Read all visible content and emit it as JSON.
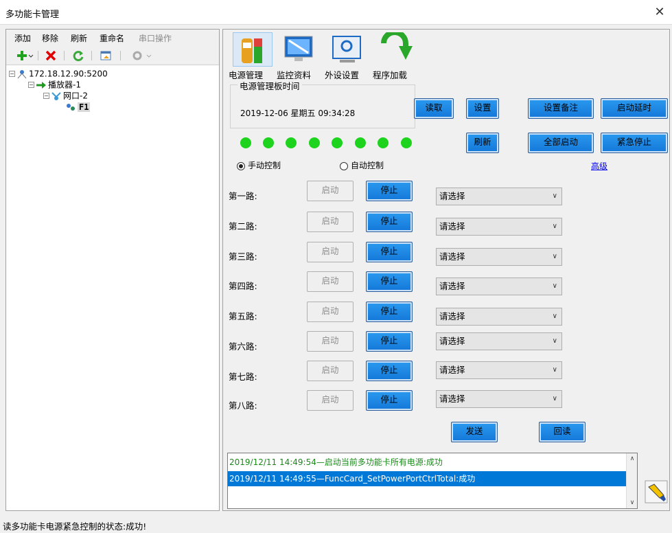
{
  "window": {
    "title": "多功能卡管理",
    "close_glyph": "✕"
  },
  "menu": {
    "items": [
      "添加",
      "移除",
      "刷新",
      "重命名",
      "串口操作"
    ]
  },
  "toolbar": {
    "icons": [
      "add-icon",
      "delete-icon",
      "refresh-icon",
      "window-icon",
      "settings-icon"
    ],
    "colors": {
      "add": "#1fa31f",
      "delete": "#e00000",
      "refresh": "#3aa83a"
    }
  },
  "tree": {
    "root": "172.18.12.90:5200",
    "player": "播放器-1",
    "port": "网口-2",
    "card": "F1"
  },
  "tabs": [
    {
      "label": "电源管理",
      "icon": "power-management-icon"
    },
    {
      "label": "监控资料",
      "icon": "monitor-icon"
    },
    {
      "label": "外设设置",
      "icon": "peripheral-icon"
    },
    {
      "label": "程序加载",
      "icon": "program-load-icon"
    }
  ],
  "power_time": {
    "legend": "电源管理板时间",
    "value": "2019-12-06 星期五 09:34:28"
  },
  "buttons": {
    "read": "读取",
    "set": "设置",
    "set_note": "设置备注",
    "start_delay": "启动延时",
    "refresh": "刷新",
    "start_all": "全部启动",
    "emergency_stop": "紧急停止",
    "send": "发送",
    "readback": "回读"
  },
  "leds": {
    "count": 8,
    "color": "#1ed31e"
  },
  "control_mode": {
    "manual": "手动控制",
    "auto": "自动控制",
    "selected": "manual"
  },
  "advanced_link": "高级",
  "channels": [
    {
      "label": "第一路:",
      "start": "启动",
      "stop": "停止",
      "select": "请选择"
    },
    {
      "label": "第二路:",
      "start": "启动",
      "stop": "停止",
      "select": "请选择"
    },
    {
      "label": "第三路:",
      "start": "启动",
      "stop": "停止",
      "select": "请选择"
    },
    {
      "label": "第四路:",
      "start": "启动",
      "stop": "停止",
      "select": "请选择"
    },
    {
      "label": "第五路:",
      "start": "启动",
      "stop": "停止",
      "select": "请选择"
    },
    {
      "label": "第六路:",
      "start": "启动",
      "stop": "停止",
      "select": "请选择"
    },
    {
      "label": "第七路:",
      "start": "启动",
      "stop": "停止",
      "select": "请选择"
    },
    {
      "label": "第八路:",
      "start": "启动",
      "stop": "停止",
      "select": "请选择"
    }
  ],
  "log": {
    "lines": [
      "2019/12/11 14:49:54—启动当前多功能卡所有电源:成功",
      "2019/12/11 14:49:55—FuncCard_SetPowerPortCtrlTotal:成功"
    ],
    "colors": {
      "success": "#1a8a1a",
      "selected_bg": "#0078d7"
    }
  },
  "status": {
    "text": "读多功能卡电源紧急控制的状态:成功!"
  }
}
